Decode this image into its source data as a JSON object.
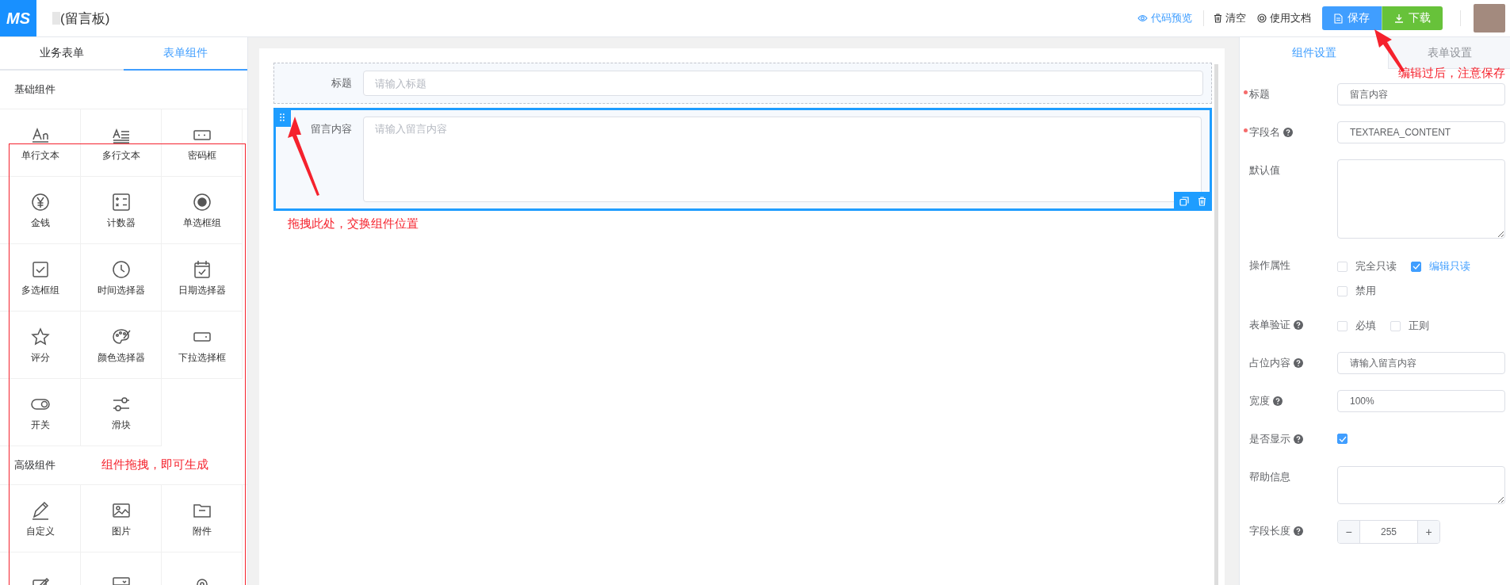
{
  "header": {
    "logo": "MS",
    "title": "(留言板)",
    "actions": [
      {
        "kind": "preview",
        "label": "代码预览"
      },
      {
        "kind": "clear",
        "label": "清空"
      },
      {
        "kind": "docs",
        "label": "使用文档"
      }
    ],
    "buttons": [
      {
        "kind": "save",
        "label": "保存"
      },
      {
        "kind": "download",
        "label": "下载"
      }
    ]
  },
  "left_tabs": [
    {
      "label": "业务表单",
      "selected": false
    },
    {
      "label": "表单组件",
      "selected": true
    }
  ],
  "groups": [
    {
      "title": "基础组件",
      "items": [
        {
          "kind": "input",
          "label": "单行文本"
        },
        {
          "kind": "textarea",
          "label": "多行文本"
        },
        {
          "kind": "password",
          "label": "密码框"
        },
        {
          "kind": "money",
          "label": "金钱"
        },
        {
          "kind": "counter",
          "label": "计数器"
        },
        {
          "kind": "radio",
          "label": "单选框组"
        },
        {
          "kind": "checkbox",
          "label": "多选框组"
        },
        {
          "kind": "time",
          "label": "时间选择器"
        },
        {
          "kind": "date",
          "label": "日期选择器"
        },
        {
          "kind": "rate",
          "label": "评分"
        },
        {
          "kind": "color",
          "label": "颜色选择器"
        },
        {
          "kind": "select",
          "label": "下拉选择框"
        },
        {
          "kind": "switch",
          "label": "开关"
        },
        {
          "kind": "slider",
          "label": "滑块"
        }
      ]
    },
    {
      "title": "高级组件",
      "items": [
        {
          "kind": "custom",
          "label": "自定义"
        },
        {
          "kind": "image",
          "label": "图片"
        },
        {
          "kind": "file",
          "label": "附件"
        },
        {
          "kind": "editor"
        },
        {
          "kind": "cascader"
        },
        {
          "kind": "location"
        }
      ]
    }
  ],
  "canvas": {
    "items": [
      {
        "kind": "input",
        "label": "标题",
        "placeholder": "请输入标题",
        "selected": false
      },
      {
        "kind": "textarea",
        "label": "留言内容",
        "placeholder": "请输入留言内容",
        "selected": true
      }
    ],
    "hint": "拖拽此处，交换组件位置"
  },
  "right_tabs": [
    {
      "label": "组件设置",
      "selected": true
    },
    {
      "label": "表单设置",
      "selected": false
    }
  ],
  "settings": [
    {
      "kind": "input",
      "label": "标题",
      "required": true,
      "help": false,
      "value": "留言内容"
    },
    {
      "kind": "input",
      "label": "字段名",
      "required": true,
      "help": true,
      "value": "TEXTAREA_CONTENT"
    },
    {
      "kind": "textarea",
      "label": "默认值",
      "required": false,
      "help": false
    },
    {
      "kind": "checkboxes",
      "label": "操作属性",
      "required": false,
      "help": false,
      "options": [
        {
          "label": "完全只读",
          "checked": false
        },
        {
          "label": "编辑只读",
          "checked": true
        },
        {
          "label": "禁用",
          "checked": false
        }
      ]
    },
    {
      "kind": "checkboxes",
      "label": "表单验证",
      "required": false,
      "help": true,
      "options": [
        {
          "label": "必填",
          "checked": false
        },
        {
          "label": "正则",
          "checked": false
        }
      ]
    },
    {
      "kind": "input",
      "label": "占位内容",
      "required": false,
      "help": true,
      "value": "请输入留言内容"
    },
    {
      "kind": "input",
      "label": "宽度",
      "required": false,
      "help": true,
      "value": "100%"
    },
    {
      "kind": "checkbox",
      "label": "是否显示",
      "required": false,
      "help": true,
      "checked": true
    },
    {
      "kind": "textarea",
      "label": "帮助信息",
      "required": false,
      "help": false
    },
    {
      "kind": "number",
      "label": "字段长度",
      "required": false,
      "help": true,
      "value": "255",
      "minus": "−",
      "plus": "+"
    }
  ],
  "annotations": {
    "components": "组件拖拽，即可生成",
    "save": "编辑过后，注意保存"
  }
}
